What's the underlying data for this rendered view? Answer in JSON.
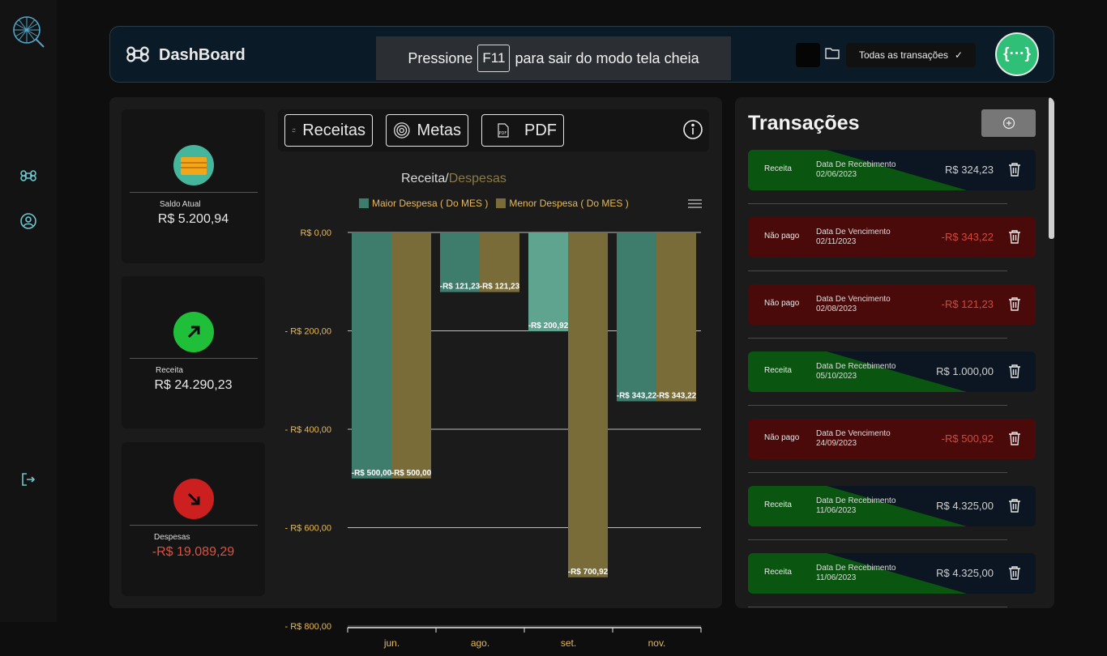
{
  "header": {
    "title": "DashBoard",
    "fullscreen_prefix": "Pressione",
    "fullscreen_key": "F11",
    "fullscreen_suffix": "para sair do modo tela cheia",
    "filter_label": "Todas as transações",
    "avatar_text": "{···}"
  },
  "summary": [
    {
      "label": "Saldo Atual",
      "value": "R$ 5.200,94",
      "icon": "wallet-icon",
      "color": "#45b69c",
      "value_color": "#e8e8e8"
    },
    {
      "label": "Receita",
      "value": "R$ 24.290,23",
      "icon": "arrow-up-right-icon",
      "color": "#1fbf3a",
      "value_color": "#e8e8e8"
    },
    {
      "label": "Despesas",
      "value": "-R$ 19.089,29",
      "icon": "arrow-down-right-icon",
      "color": "#cc1f1f",
      "value_color": "#e0503f"
    }
  ],
  "toolbar": {
    "receitas": "Receitas",
    "metas": "Metas",
    "pdf": "PDF",
    "pdf_icon_text": "PDF"
  },
  "chart_title": {
    "a": "Receita/",
    "b": "Despesas"
  },
  "colors": {
    "series1": "#3e7d6c",
    "series2": "#7a6c38",
    "tick": "#e7b957",
    "highlight": "#5ea48f"
  },
  "chart_data": {
    "type": "bar",
    "categories": [
      "jun.",
      "ago.",
      "set.",
      "nov."
    ],
    "series": [
      {
        "name": "Maior Despesa ( Do MES )",
        "values": [
          -500.0,
          -121.23,
          -200.92,
          -343.22
        ],
        "labels": [
          "-R$ 500,00",
          "-R$ 121,23",
          "-R$ 200,92",
          "-R$ 343,22"
        ]
      },
      {
        "name": "Menor Despesa ( Do MES )",
        "values": [
          -500.0,
          -121.23,
          -700.92,
          -343.22
        ],
        "labels": [
          "-R$ 500,00",
          "-R$ 121,23",
          "-R$ 700,92",
          "-R$ 343,22"
        ]
      }
    ],
    "yticks": [
      "R$ 0,00",
      "- R$ 200,00",
      "- R$ 400,00",
      "- R$ 600,00",
      "- R$ 800,00"
    ],
    "ylim": [
      -800,
      0
    ],
    "grid": true,
    "legend": "top"
  },
  "transactions": {
    "title": "Transações",
    "items": [
      {
        "status": "Receita",
        "date_label": "Data De Recebimento",
        "date": "02/06/2023",
        "amount": "R$ 324,23",
        "kind": "receita"
      },
      {
        "status": "Não pago",
        "date_label": "Data De Vencimento",
        "date": "02/11/2023",
        "amount": "-R$ 343,22",
        "kind": "naopago"
      },
      {
        "status": "Não pago",
        "date_label": "Data De Vencimento",
        "date": "02/08/2023",
        "amount": "-R$ 121,23",
        "kind": "naopago"
      },
      {
        "status": "Receita",
        "date_label": "Data De Recebimento",
        "date": "05/10/2023",
        "amount": "R$ 1.000,00",
        "kind": "receita"
      },
      {
        "status": "Não pago",
        "date_label": "Data De Vencimento",
        "date": "24/09/2023",
        "amount": "-R$ 500,92",
        "kind": "naopago"
      },
      {
        "status": "Receita",
        "date_label": "Data De Recebimento",
        "date": "11/06/2023",
        "amount": "R$ 4.325,00",
        "kind": "receita"
      },
      {
        "status": "Receita",
        "date_label": "Data De Recebimento",
        "date": "11/06/2023",
        "amount": "R$ 4.325,00",
        "kind": "receita"
      }
    ]
  }
}
